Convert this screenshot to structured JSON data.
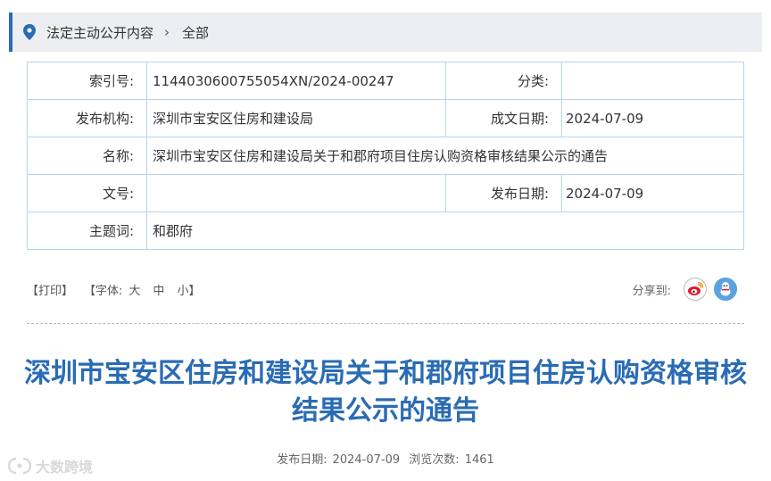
{
  "breadcrumb": {
    "items": [
      "法定主动公开内容",
      "全部"
    ],
    "separator": "›"
  },
  "meta": {
    "index_label": "索引号:",
    "index_value": "1144030600755054XN/2024-00247",
    "category_label": "分类:",
    "category_value": "",
    "issuer_label": "发布机构:",
    "issuer_value": "深圳市宝安区住房和建设局",
    "created_label": "成文日期:",
    "created_value": "2024-07-09",
    "name_label": "名称:",
    "name_value": "深圳市宝安区住房和建设局关于和郡府项目住房认购资格审核结果公示的通告",
    "docno_label": "文号:",
    "docno_value": "",
    "published_label": "发布日期:",
    "published_value": "2024-07-09",
    "subject_label": "主题词:",
    "subject_value": "和郡府"
  },
  "tools": {
    "print": "【打印】",
    "font_label": "【字体:",
    "font_large": "大",
    "font_medium": "中",
    "font_small": "小】",
    "share_label": "分享到:",
    "share_icons": [
      "weibo-icon",
      "qq-icon"
    ]
  },
  "article": {
    "title": "深圳市宝安区住房和建设局关于和郡府项目住房认购资格审核结果公示的通告",
    "pub_date_label": "发布日期:",
    "pub_date": "2024-07-09",
    "views_label": "浏览次数:",
    "views": "1461"
  },
  "watermark": {
    "text": "大数跨境"
  },
  "colors": {
    "accent": "#2a6cb4",
    "border": "#bcd3ea",
    "breadcrumb_bg": "#eceef1",
    "weibo": "#e6162d",
    "qq": "#5ba3e0"
  }
}
